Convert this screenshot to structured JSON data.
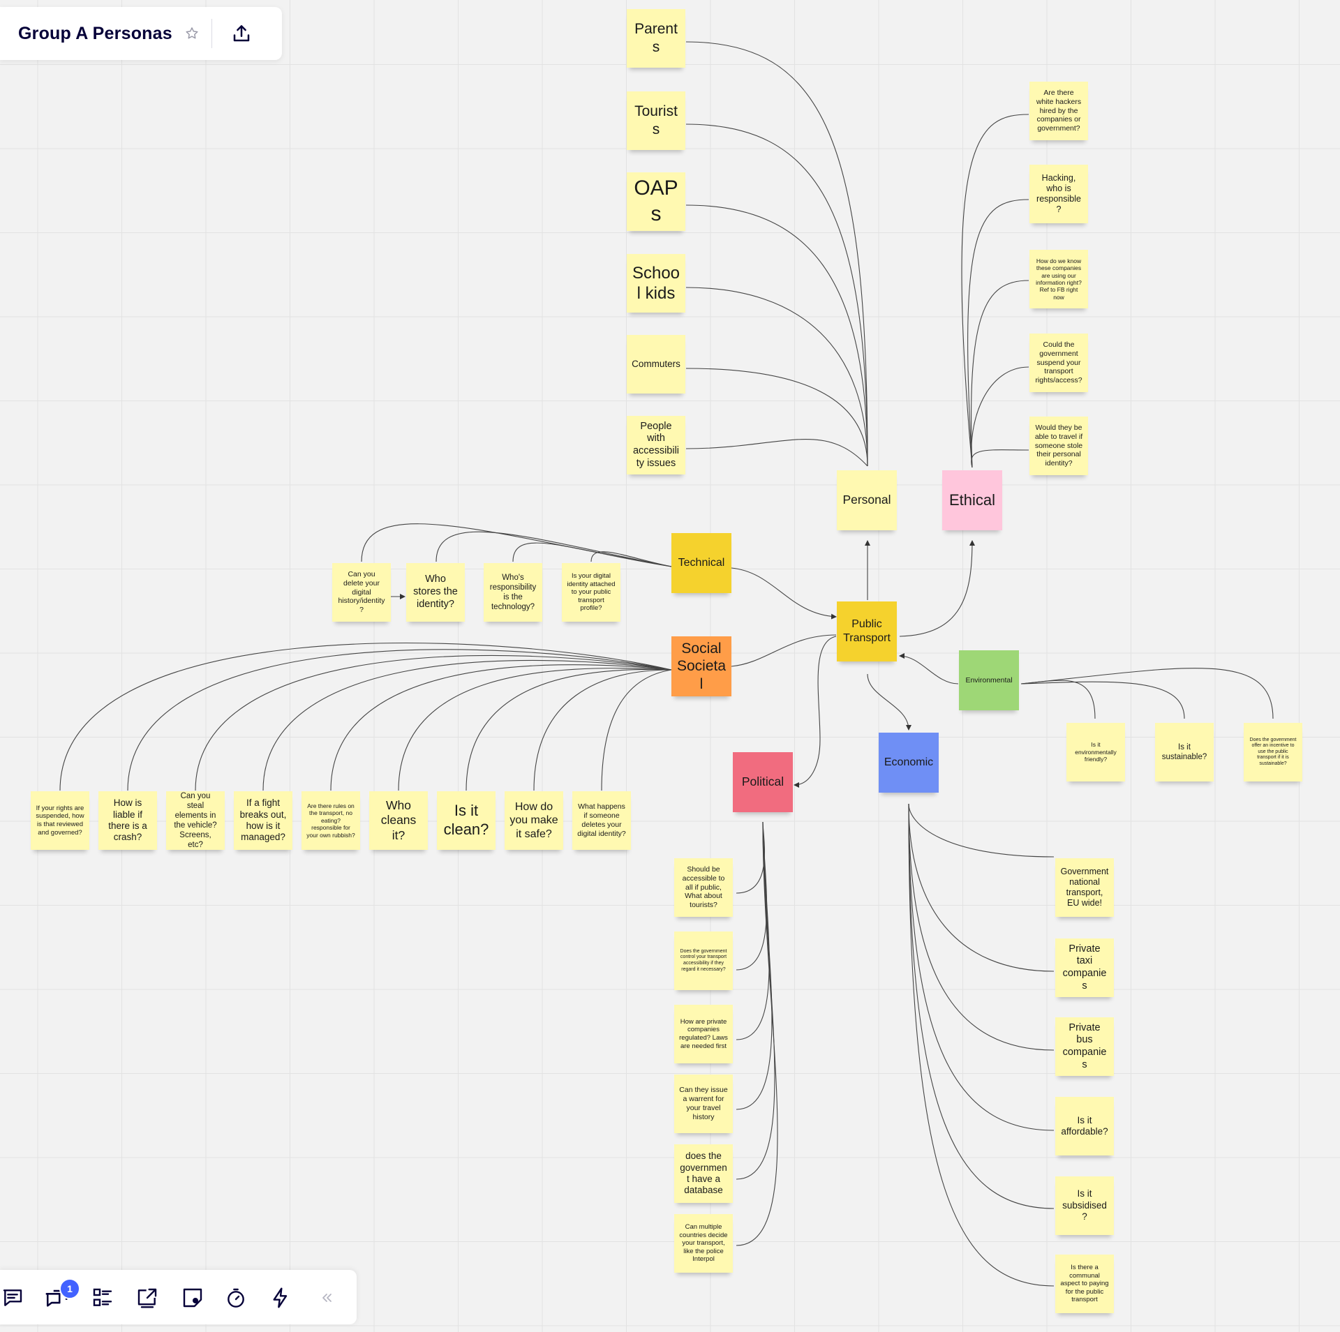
{
  "board": {
    "title": "Group A Personas",
    "star_icon": "star-icon",
    "share_icon": "share-upload-icon"
  },
  "colors": {
    "sticky_yellow_light": "#fff9b1",
    "sticky_yellow": "#f5d22d",
    "sticky_orange": "#ff9d48",
    "sticky_pink": "#ffc6dc",
    "sticky_green": "#9ed776",
    "sticky_blue": "#6f8ff5",
    "sticky_red": "#f16c7f",
    "badge_blue": "#4262ff"
  },
  "notes": {
    "personas": [
      "Parents",
      "Tourists",
      "OAPs",
      "School kids",
      "Commuters",
      "People with accessibility issues"
    ],
    "ethical_questions": [
      "Are there white hackers hired by the companies or government?",
      "Hacking, who is responsible?",
      "How do we know these companies are using our information right? Ref to FB right now",
      "Could the government suspend your transport rights/access?",
      "Would they be able to travel if someone stole their personal identity?"
    ],
    "categories": {
      "personal": "Personal",
      "ethical": "Ethical",
      "technical": "Technical",
      "public_transport": "Public Transport",
      "social": "Social Societal",
      "environmental": "Environmental",
      "economic": "Economic",
      "political": "Political"
    },
    "technical_questions": [
      "Can you delete your digital history/identity?",
      "Who stores the identity?",
      "Who's responsibility is the technology?",
      "Is your digital identity attached to your public transport profile?"
    ],
    "social_questions": [
      "If your rights are suspended, how is that reviewed and governed?",
      "How is liable if there is a crash?",
      "Can you steal elements in the vehicle? Screens, etc?",
      "If a fight breaks out, how is it managed?",
      "Are there rules on the transport, no eating? responsible for your own rubbish?",
      "Who cleans it?",
      "Is it clean?",
      "How do you make it safe?",
      "What happens if someone deletes your digital identity?"
    ],
    "environmental_questions": [
      "Is it environmentally friendly?",
      "Is it sustainable?",
      "Does the government offer an incentive to use the public transport if it is sustainable?"
    ],
    "political_questions": [
      "Should be accessible to all if public, What about tourists?",
      "Does the government control your transport accessibility if they regard it necessary?",
      "How are private companies regulated? Laws are needed first",
      "Can they issue a warrent for your travel history",
      "does the government have a database",
      "Can multiple countries decide your transport, like the police Interpol"
    ],
    "economic_questions": [
      "Government national transport, EU wide!",
      "Private taxi companies",
      "Private bus companies",
      "Is it affordable?",
      "Is it subsidised?",
      "Is there a communal aspect to paying for the public transport"
    ]
  },
  "toolbar": {
    "tools": [
      "comments-icon",
      "chat-icon",
      "card-list-icon",
      "share-screen-icon",
      "sticky-note-icon",
      "timer-icon",
      "lightning-icon",
      "collapse-chevrons-icon"
    ],
    "chat_badge": "1"
  }
}
